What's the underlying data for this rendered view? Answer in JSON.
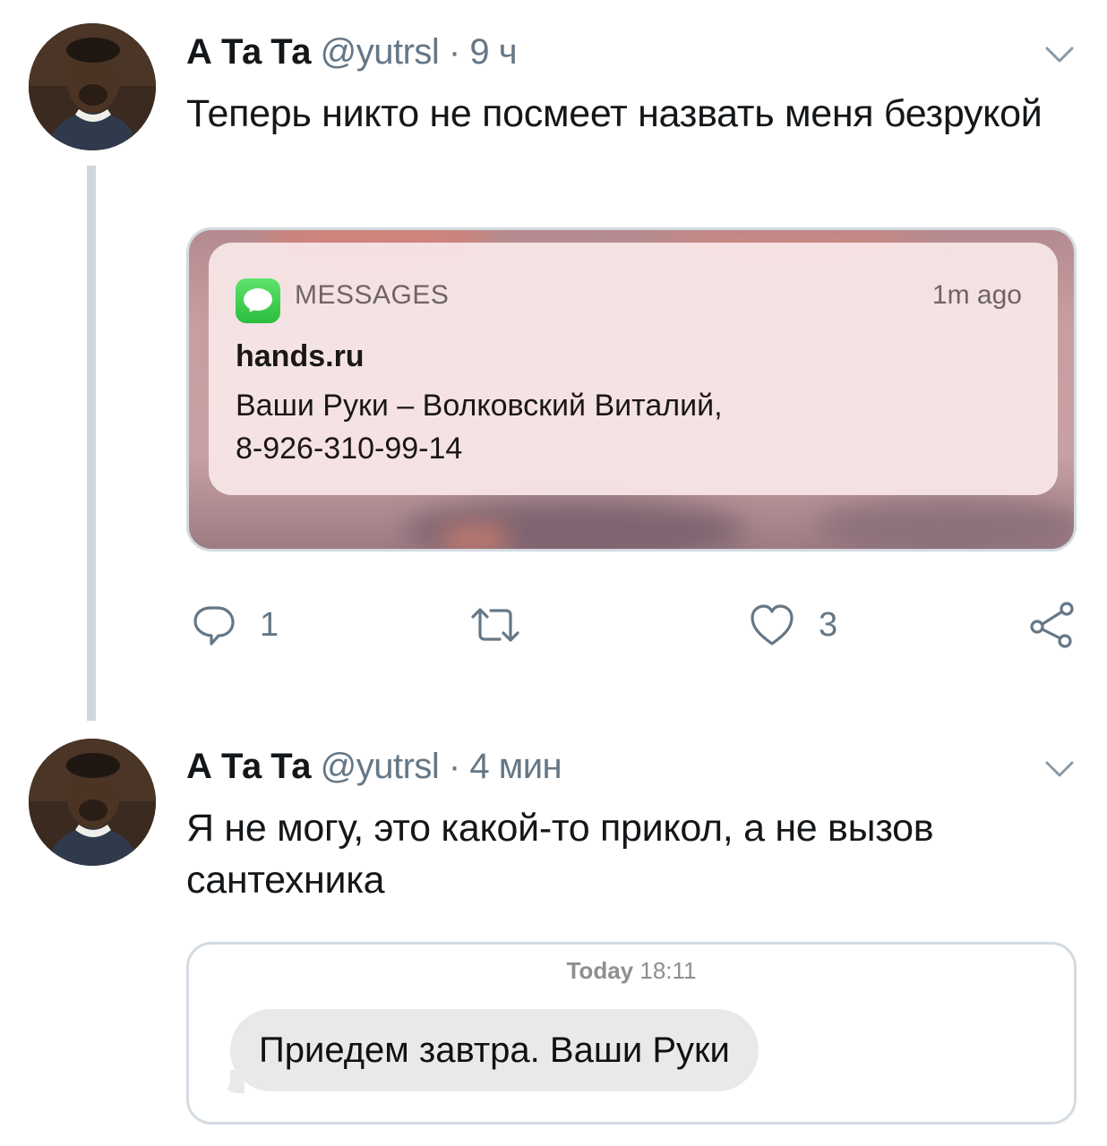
{
  "tweets": [
    {
      "author_name": "А Та Та",
      "handle": "@yutrsl",
      "time": "9 ч",
      "text": "Теперь никто не посмеет назвать меня безрукой",
      "notification": {
        "app": "MESSAGES",
        "time": "1m ago",
        "title": "hands.ru",
        "body_line1": "Ваши Руки – Волковский Виталий,",
        "body_line2": "8-926-310-99-14"
      },
      "actions": {
        "reply_count": "1",
        "retweet_count": "",
        "like_count": "3"
      }
    },
    {
      "author_name": "А Та Та",
      "handle": "@yutrsl",
      "time": "4 мин",
      "text": "Я не могу, это какой-то прикол, а не вызов сантехника",
      "message_screenshot": {
        "date_label": "Today",
        "time_label": "18:11",
        "message": "Приедем завтра. Ваши Руки"
      }
    }
  ],
  "icons": {
    "reply": "reply-icon",
    "retweet": "retweet-icon",
    "like": "heart-icon",
    "share": "share-icon",
    "menu": "chevron-down-icon",
    "messages_app": "messages-app-icon"
  },
  "colors": {
    "text_primary": "#14171a",
    "text_secondary": "#657786",
    "thread_line": "#cfd6dc",
    "border": "#d3dbe2",
    "imessage_bubble": "#e9e9eb",
    "messages_green": "#34c759"
  }
}
